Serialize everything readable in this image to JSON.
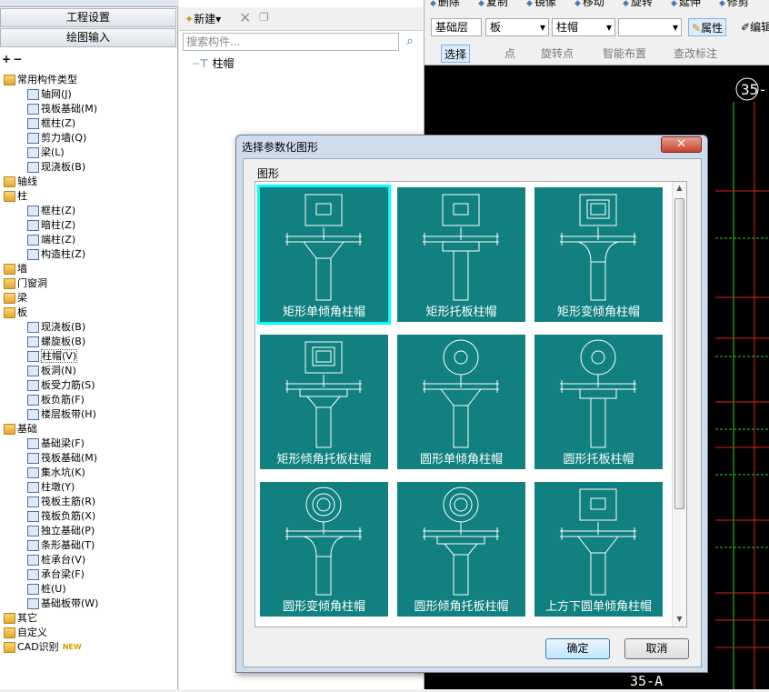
{
  "nav": {
    "top_buttons": [
      "工程设置",
      "绘图输入"
    ],
    "tree": [
      {
        "label": "常用构件类型",
        "level": 0,
        "type": "folder"
      },
      {
        "label": "轴网(J)",
        "level": 1,
        "type": "grid"
      },
      {
        "label": "筏板基础(M)",
        "level": 1,
        "type": "comp"
      },
      {
        "label": "框柱(Z)",
        "level": 1,
        "type": "col"
      },
      {
        "label": "剪力墙(Q)",
        "level": 1,
        "type": "comp"
      },
      {
        "label": "梁(L)",
        "level": 1,
        "type": "beam"
      },
      {
        "label": "现浇板(B)",
        "level": 1,
        "type": "comp"
      },
      {
        "label": "轴线",
        "level": 0,
        "type": "folder"
      },
      {
        "label": "柱",
        "level": 0,
        "type": "folder"
      },
      {
        "label": "框柱(Z)",
        "level": 1,
        "type": "col"
      },
      {
        "label": "暗柱(Z)",
        "level": 1,
        "type": "col"
      },
      {
        "label": "端柱(Z)",
        "level": 1,
        "type": "col"
      },
      {
        "label": "构造柱(Z)",
        "level": 1,
        "type": "col"
      },
      {
        "label": "墙",
        "level": 0,
        "type": "folder"
      },
      {
        "label": "门窗洞",
        "level": 0,
        "type": "folder"
      },
      {
        "label": "梁",
        "level": 0,
        "type": "folder"
      },
      {
        "label": "板",
        "level": 0,
        "type": "folder"
      },
      {
        "label": "现浇板(B)",
        "level": 1,
        "type": "comp"
      },
      {
        "label": "螺旋板(B)",
        "level": 1,
        "type": "comp"
      },
      {
        "label": "柱帽(V)",
        "level": 1,
        "type": "cap"
      },
      {
        "label": "板洞(N)",
        "level": 1,
        "type": "comp"
      },
      {
        "label": "板受力筋(S)",
        "level": 1,
        "type": "comp"
      },
      {
        "label": "板负筋(F)",
        "level": 1,
        "type": "comp"
      },
      {
        "label": "楼层板带(H)",
        "level": 1,
        "type": "comp"
      },
      {
        "label": "基础",
        "level": 0,
        "type": "folder"
      },
      {
        "label": "基础梁(F)",
        "level": 1,
        "type": "comp"
      },
      {
        "label": "筏板基础(M)",
        "level": 1,
        "type": "comp"
      },
      {
        "label": "集水坑(K)",
        "level": 1,
        "type": "comp"
      },
      {
        "label": "柱墩(Y)",
        "level": 1,
        "type": "comp"
      },
      {
        "label": "筏板主筋(R)",
        "level": 1,
        "type": "comp"
      },
      {
        "label": "筏板负筋(X)",
        "level": 1,
        "type": "comp"
      },
      {
        "label": "独立基础(P)",
        "level": 1,
        "type": "comp"
      },
      {
        "label": "条形基础(T)",
        "level": 1,
        "type": "comp"
      },
      {
        "label": "桩承台(V)",
        "level": 1,
        "type": "comp"
      },
      {
        "label": "承台梁(F)",
        "level": 1,
        "type": "comp"
      },
      {
        "label": "桩(U)",
        "level": 1,
        "type": "comp"
      },
      {
        "label": "基础板带(W)",
        "level": 1,
        "type": "comp"
      },
      {
        "label": "其它",
        "level": 0,
        "type": "folder"
      },
      {
        "label": "自定义",
        "level": 0,
        "type": "folder"
      },
      {
        "label": "CAD识别",
        "level": 0,
        "type": "folder",
        "badge": "NEW"
      }
    ]
  },
  "middle": {
    "new_label": "新建",
    "search_placeholder": "搜索构件...",
    "tree_item": "柱帽"
  },
  "toolbar": {
    "row1": [
      "删除",
      "复制",
      "镜像",
      "移动",
      "旋转",
      "延伸",
      "修剪"
    ],
    "floor": "基础层",
    "type": "板",
    "component": "柱帽",
    "properties": "属性",
    "edit": "编辑",
    "row3": [
      "选择",
      "点",
      "旋转点",
      "智能布置",
      "查改标注"
    ]
  },
  "cad": {
    "label_top": "35-",
    "label_bottom": "35-A",
    "line_color": "#e02020",
    "grid_color": "#2bd62b"
  },
  "dialog": {
    "title": "选择参数化图形",
    "group_label": "图形",
    "ok": "确定",
    "cancel": "取消",
    "selected_index": 0,
    "accent": "#108080",
    "items": [
      {
        "caption": "矩形单倾角柱帽",
        "top": "square",
        "shape": "single"
      },
      {
        "caption": "矩形托板柱帽",
        "top": "square",
        "shape": "plate"
      },
      {
        "caption": "矩形变倾角柱帽",
        "top": "square2",
        "shape": "variable"
      },
      {
        "caption": "矩形倾角托板柱帽",
        "top": "square2",
        "shape": "angleplate"
      },
      {
        "caption": "圆形单倾角柱帽",
        "top": "circle",
        "shape": "single"
      },
      {
        "caption": "圆形托板柱帽",
        "top": "circle",
        "shape": "plate"
      },
      {
        "caption": "圆形变倾角柱帽",
        "top": "circle2",
        "shape": "variable"
      },
      {
        "caption": "圆形倾角托板柱帽",
        "top": "circle2",
        "shape": "angleplate"
      },
      {
        "caption": "上方下圆单倾角柱帽",
        "top": "square",
        "shape": "single"
      }
    ]
  }
}
